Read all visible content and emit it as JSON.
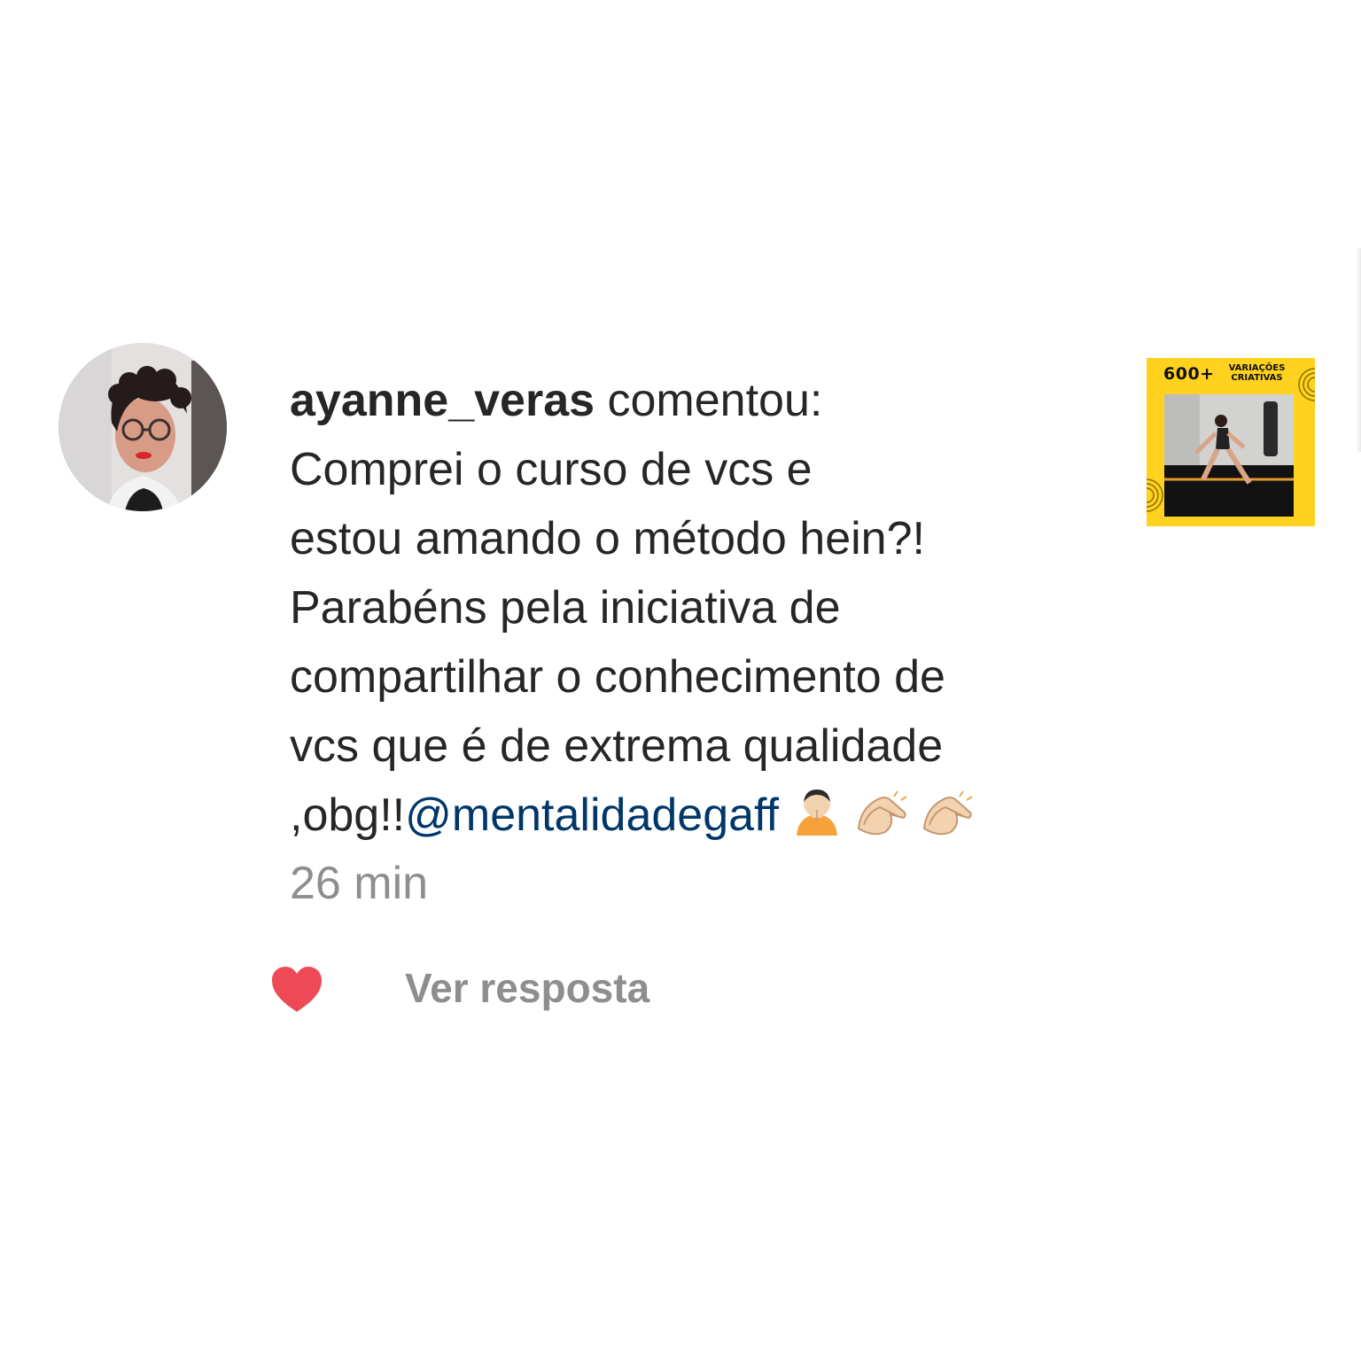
{
  "comment": {
    "username": "ayanne_veras",
    "action": "comentou:",
    "lines": [
      "Comprei o curso de vcs e",
      "estou amando o método hein?!",
      "Parabéns pela iniciativa de",
      "compartilhar o conhecimento de",
      "vcs que é de extrema qualidade"
    ],
    "last_line_prefix": ",obg!!",
    "mention": "@mentalidadegaff",
    "emojis": [
      "person-bowing-emoji",
      "clapping-hands-emoji",
      "clapping-hands-emoji"
    ],
    "timestamp": "26 min"
  },
  "actions": {
    "like_icon": "heart-icon",
    "like_color": "#ed4956",
    "view_reply_label": "Ver resposta"
  },
  "post_thumbnail": {
    "badge_number": "600+",
    "badge_line1": "VARIAÇÕES",
    "badge_line2": "CRIATIVAS",
    "background": "#ffd21f"
  },
  "colors": {
    "text": "#262626",
    "secondary": "#8e8e8e",
    "mention": "#00376b"
  }
}
